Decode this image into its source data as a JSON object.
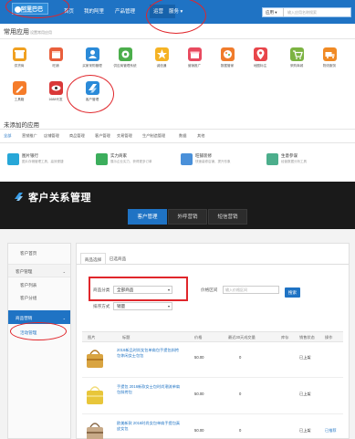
{
  "colors": {
    "brand_blue": "#1f73c4",
    "highlight_red": "#e0262b",
    "crm_header": "#1a1a1a"
  },
  "top": {
    "logo": {
      "title": "阿里巴巴",
      "subtitle": "1688.com"
    },
    "nav": [
      "首页",
      "我的阿里",
      "产品管理",
      "运营",
      "服务"
    ],
    "search": {
      "select": "应用",
      "placeholder": "输入应用名称搜索"
    },
    "common_apps": {
      "title": "常用应用",
      "subtitle": "设置常用应用",
      "items": [
        {
          "label": "供货商",
          "icon": "shop-icon",
          "color": "#f0a020"
        },
        {
          "label": "旺铺",
          "icon": "calendar-icon",
          "color": "#e95f3c"
        },
        {
          "label": "买家采购管理",
          "icon": "person-icon",
          "color": "#2a8ad8"
        },
        {
          "label": "供应商管理系统",
          "icon": "gear-icon",
          "color": "#4cae4c"
        },
        {
          "label": "诚信通",
          "icon": "star-icon",
          "color": "#f5b324"
        },
        {
          "label": "营销推广",
          "icon": "gift-icon",
          "color": "#e84a5f"
        },
        {
          "label": "数据管家",
          "icon": "palette-icon",
          "color": "#f07c2c"
        },
        {
          "label": "地图标注",
          "icon": "location-icon",
          "color": "#e8454a"
        },
        {
          "label": "采购商城",
          "icon": "cart-icon",
          "color": "#7cb342"
        },
        {
          "label": "物流服务",
          "icon": "truck-icon",
          "color": "#f08a24"
        },
        {
          "label": "工具箱",
          "icon": "pencil-icon",
          "color": "#f57c2a"
        },
        {
          "label": "1688代发",
          "icon": "eye-icon",
          "color": "#d93838"
        },
        {
          "label": "客户管理",
          "icon": "crm-app-icon",
          "color": "#2a8ad8"
        }
      ]
    },
    "recommended": {
      "title": "未添加的应用",
      "categories": [
        "全部",
        "营销推广",
        "店铺管理",
        "商品管理",
        "客户管理",
        "交易管理",
        "生产制造管理",
        "数据",
        "其他"
      ],
      "services": [
        {
          "name": "图片银行",
          "desc": "图片存储管理工具，高效便捷",
          "icon": "image-icon",
          "color": "#27a7d8"
        },
        {
          "name": "实力商家",
          "desc": "展示企业实力，获得更多订单",
          "icon": "badge-icon",
          "color": "#3cae5c"
        },
        {
          "name": "旺铺装修",
          "desc": "快速装修店铺，提升形象",
          "icon": "cube-icon",
          "color": "#4a90d9"
        },
        {
          "name": "生意参谋",
          "desc": "经营数据分析工具",
          "icon": "leaf-icon",
          "color": "#4cae8c"
        }
      ]
    }
  },
  "crm": {
    "title": "客户关系管理",
    "tabs": [
      "客户管理",
      "外呼营销",
      "短信营销"
    ],
    "sidebar": {
      "home": "客户首页",
      "group1": "客户管理",
      "group1_items": [
        "客户列表",
        "客户分组"
      ],
      "group2": "商品营销",
      "group2_items": [
        "活动管理"
      ]
    },
    "subtabs": [
      "商品选择",
      "已选商品"
    ],
    "filters": {
      "type_label": "商品分类",
      "type_value": "全部商品",
      "price_label": "价格区间",
      "price_placeholder": "输入价格区间",
      "sort_label": "排序方式",
      "sort_value": "销量",
      "search_button": "搜索"
    },
    "table": {
      "headers": [
        "图片",
        "标题",
        "价格",
        "最近30天成交量",
        "库存",
        "销售状态",
        "操作"
      ],
      "rows": [
        {
          "title": "2016新品时尚女包单肩包手提包斜挎包休闲女士包包",
          "price": "50.00",
          "volume": "0",
          "status": "已上架",
          "action": ""
        },
        {
          "title": "手提包 2016新款女士包时尚潮流单肩包斜挎包",
          "price": "50.00",
          "volume": "0",
          "status": "已上架",
          "action": ""
        },
        {
          "title": "欧美新款 2016时尚女包单肩手提包真皮女包",
          "price": "50.00",
          "volume": "0",
          "status": "已上架",
          "action": "已推荐"
        }
      ]
    }
  }
}
